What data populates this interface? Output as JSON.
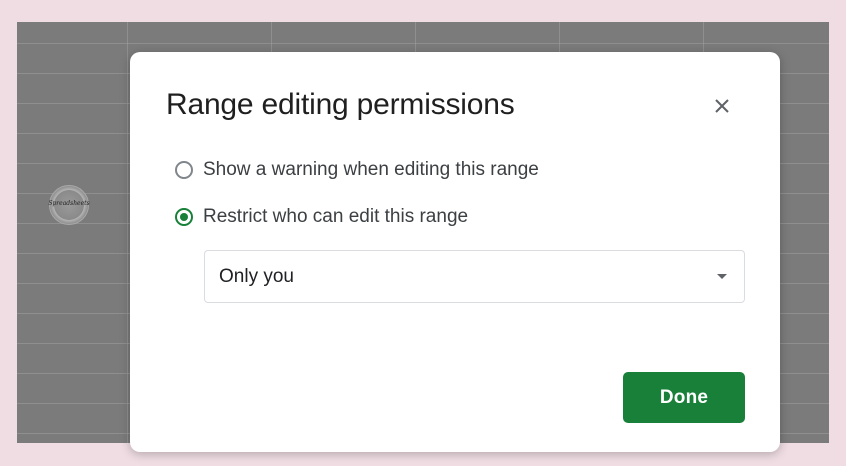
{
  "colors": {
    "page_background": "#efdde3",
    "sheet_background": "#7b7b7b",
    "accent_green": "#188038"
  },
  "dialog": {
    "title": "Range editing permissions",
    "close_icon": "close-icon",
    "options": [
      {
        "label": "Show a warning when editing this range",
        "selected": false
      },
      {
        "label": "Restrict who can edit this range",
        "selected": true
      }
    ],
    "editor_select": {
      "value": "Only you",
      "arrow_icon": "dropdown-arrow-icon"
    },
    "done_label": "Done"
  }
}
